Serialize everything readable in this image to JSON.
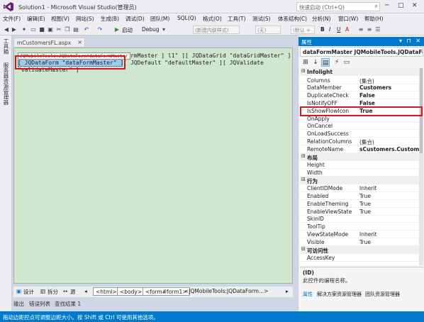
{
  "window": {
    "title": "Solution1 - Microsoft Visual Studio(管理员)",
    "quick_launch_placeholder": "快速启动 (Ctrl+Q)"
  },
  "menu": [
    "文件(F)",
    "编辑(E)",
    "视图(V)",
    "网站(S)",
    "生成(B)",
    "调试(D)",
    "团队(M)",
    "SQL(Q)",
    "格式(O)",
    "工具(T)",
    "测试(S)",
    "体系结构(C)",
    "分析(N)",
    "窗口(W)",
    "帮助(H)"
  ],
  "toolbar": {
    "start_label": "启动",
    "config": "Debug",
    "style_combo": "(新建内联样式)",
    "font_combo": "(无)",
    "font_default": "(默认 +",
    "bold": "B",
    "italic": "I",
    "underline": "U",
    "font_a": "A"
  },
  "side_tabs": [
    "工具箱",
    "服务器资源管理器"
  ],
  "document": {
    "tab_label": "mCustomersFL.aspx",
    "close": "×",
    "smart_tag": "JQMobileTools:JQDataForm#dataFormMaster",
    "lines": [
      "[ JQMobileTools:JQDataForm#dataFormMaster ] l1\" ][ JQDataGrid \"dataGridMaster\" ]",
      "[ JQDataForm \"dataFormMaster\" ][ JQDefault \"defaultMaster\" ][ JQValidate",
      "\"validateMaster\" ]"
    ]
  },
  "editor_bottom": {
    "design": "设计",
    "split": "拆分",
    "source": "源",
    "crumbs": [
      "<html>",
      "<body>",
      "<form#form1>",
      "<JQMobileTools:JQDataForm...>"
    ]
  },
  "output_tabs": [
    "输出",
    "错误列表",
    "查找结果 1"
  ],
  "status": "拖动边距控点可调整边距大小。按 Shift 或 Ctrl 可使用其他选项。",
  "properties": {
    "header": "属性",
    "object": "dataFormMaster JQMobileTools.JQDataForm",
    "categories": [
      {
        "name": "Infolight",
        "rows": [
          {
            "name": "Columns",
            "value": "(集合)",
            "bold": false
          },
          {
            "name": "DataMember",
            "value": "Customers",
            "bold": true
          },
          {
            "name": "DuplicateCheck",
            "value": "False",
            "bold": true
          },
          {
            "name": "IsNotifyOFF",
            "value": "False",
            "bold": true
          },
          {
            "name": "IsShowFlowIcon",
            "value": "True",
            "bold": true
          },
          {
            "name": "OnApply",
            "value": "",
            "bold": false
          },
          {
            "name": "OnCancel",
            "value": "",
            "bold": false
          },
          {
            "name": "OnLoadSuccess",
            "value": "",
            "bold": false
          },
          {
            "name": "RelationColumns",
            "value": "(集合)",
            "bold": false
          },
          {
            "name": "RemoteName",
            "value": "sCustomers.Customers",
            "bold": true
          }
        ]
      },
      {
        "name": "布局",
        "rows": [
          {
            "name": "Height",
            "value": "",
            "bold": false
          },
          {
            "name": "Width",
            "value": "",
            "bold": false
          }
        ]
      },
      {
        "name": "行为",
        "rows": [
          {
            "name": "ClientIDMode",
            "value": "Inherit",
            "bold": false
          },
          {
            "name": "Enabled",
            "value": "True",
            "bold": false
          },
          {
            "name": "EnableTheming",
            "value": "True",
            "bold": false
          },
          {
            "name": "EnableViewState",
            "value": "True",
            "bold": false
          },
          {
            "name": "SkinID",
            "value": "",
            "bold": false
          },
          {
            "name": "ToolTip",
            "value": "",
            "bold": false
          },
          {
            "name": "ViewStateMode",
            "value": "Inherit",
            "bold": false
          },
          {
            "name": "Visible",
            "value": "True",
            "bold": false
          }
        ]
      },
      {
        "name": "可访问性",
        "rows": [
          {
            "name": "AccessKey",
            "value": "",
            "bold": false
          }
        ]
      }
    ],
    "description_title": "(ID)",
    "description_text": "此控件的编程名称。",
    "bottom_tabs": [
      "属性",
      "解决方案资源管理器",
      "团队资源管理器"
    ]
  },
  "colors": {
    "accent": "#007acc",
    "highlight_box": "#d01a1f",
    "editor_bg": "#cfe6cf"
  }
}
